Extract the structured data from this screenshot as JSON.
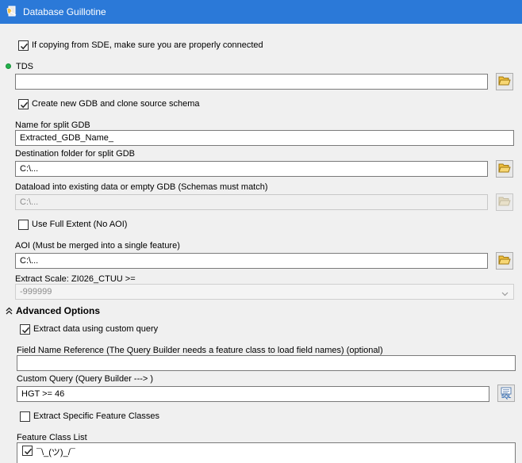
{
  "window": {
    "title": "Database Guillotine"
  },
  "form": {
    "sde_check": {
      "label": "If copying from SDE, make sure you are properly connected",
      "checked": true
    },
    "tds": {
      "label": "TDS",
      "value": ""
    },
    "create_gdb": {
      "label": "Create new GDB and clone source schema",
      "checked": true
    },
    "split_name": {
      "label": "Name for split GDB",
      "value": "Extracted_GDB_Name_"
    },
    "dest_folder": {
      "label": "Destination folder for split GDB",
      "value": "C:\\..."
    },
    "dataload": {
      "label": "Dataload into existing data or empty GDB (Schemas must match)",
      "value": "C:\\..."
    },
    "full_extent": {
      "label": "Use Full Extent (No AOI)",
      "checked": false
    },
    "aoi": {
      "label": "AOI (Must be merged into a single feature)",
      "value": "C:\\..."
    },
    "extract_scale": {
      "label": "Extract Scale: ZI026_CTUU >=",
      "value": "-999999"
    }
  },
  "advanced": {
    "header": "Advanced Options",
    "custom_query_check": {
      "label": "Extract data using custom query",
      "checked": true
    },
    "field_ref": {
      "label": "Field Name Reference (The Query Builder needs a feature class to load field names) (optional)",
      "value": ""
    },
    "custom_query": {
      "label": "Custom Query (Query Builder ---> )",
      "value": "HGT >= 46"
    },
    "sql_button_label": "SQL",
    "specific_fc": {
      "label": "Extract Specific Feature Classes",
      "checked": false
    },
    "fc_list": {
      "label": "Feature Class List",
      "items": [
        {
          "label": "¯\\_(ツ)_/¯",
          "checked": true
        }
      ]
    }
  },
  "colors": {
    "titlebar": "#2b79d8",
    "background": "#f0f0f0",
    "required_dot": "#22b14c"
  },
  "icons": {
    "app": "script-tool-icon",
    "browse": "open-folder-icon",
    "collapse": "double-chevron-up-icon",
    "dropdown": "chevron-down-icon",
    "sql": "sql-query-builder-icon"
  }
}
